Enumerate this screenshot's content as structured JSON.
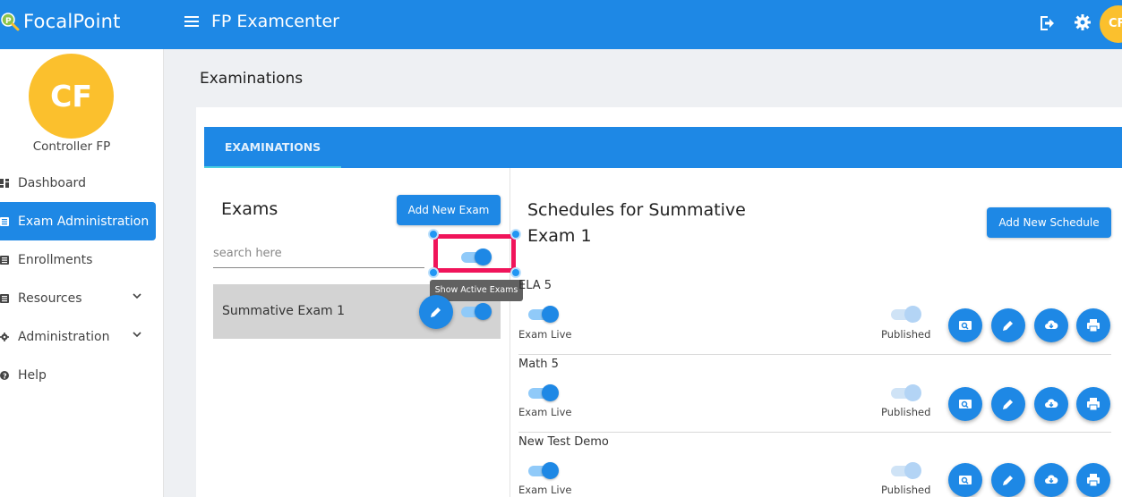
{
  "header": {
    "brand": "FocalPoint",
    "app_title": "FP Examcenter",
    "avatar_initials": "CF"
  },
  "sidebar": {
    "avatar_initials": "CF",
    "user_name": "Controller FP",
    "items": [
      {
        "label": "Dashboard",
        "icon": "dashboard-icon"
      },
      {
        "label": "Exam Administration",
        "icon": "list-icon",
        "active": true
      },
      {
        "label": "Enrollments",
        "icon": "list-icon"
      },
      {
        "label": "Resources",
        "icon": "list-icon",
        "expandable": true
      },
      {
        "label": "Administration",
        "icon": "gear-icon",
        "expandable": true
      },
      {
        "label": "Help",
        "icon": "help-icon"
      }
    ]
  },
  "page": {
    "title": "Examinations",
    "tab": "EXAMINATIONS"
  },
  "exams": {
    "title": "Exams",
    "add_button": "Add New Exam",
    "search_placeholder": "search here",
    "active_toggle_tooltip": "Show Active Exams",
    "list": [
      {
        "name": "Summative Exam 1",
        "active": true
      }
    ]
  },
  "schedules": {
    "title": "Schedules for Summative Exam 1",
    "add_button": "Add New Schedule",
    "live_label": "Exam Live",
    "published_label": "Published",
    "items": [
      {
        "name": "ELA 5",
        "live": true,
        "published": true
      },
      {
        "name": "Math 5",
        "live": true,
        "published": true
      },
      {
        "name": "New Test Demo",
        "live": true,
        "published": true
      }
    ]
  },
  "colors": {
    "primary": "#1e88e5",
    "avatar": "#fbc02d",
    "highlight": "#f0145a",
    "tab_indicator": "#4dd0e1"
  }
}
